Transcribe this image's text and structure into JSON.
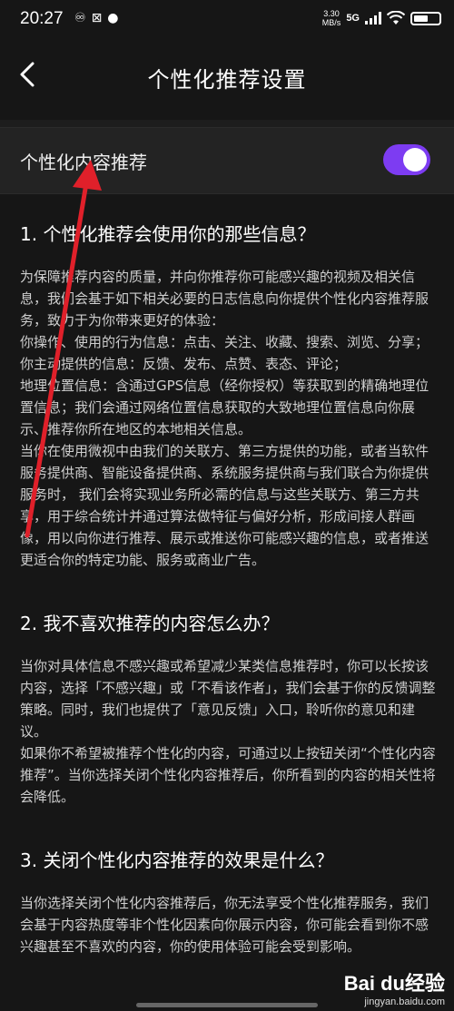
{
  "status": {
    "time": "20:27",
    "left_icons": [
      "♾",
      "⊠",
      "●"
    ],
    "speed_top": "3.30",
    "speed_bottom": "MB/s",
    "network": "5G",
    "battery_level_percent": 56
  },
  "header": {
    "title": "个性化推荐设置"
  },
  "toggle": {
    "label": "个性化内容推荐",
    "on": true,
    "color": "#7d3cf2"
  },
  "sections": [
    {
      "title": "1. 个性化推荐会使用你的那些信息？",
      "paragraphs": [
        "为保障推荐内容的质量，并向你推荐你可能感兴趣的视频及相关信息，我们会基于如下相关必要的日志信息向你提供个性化内容推荐服务，致力于为你带来更好的体验：",
        "你操作、使用的行为信息：点击、关注、收藏、搜索、浏览、分享；",
        "你主动提供的信息：反馈、发布、点赞、表态、评论；",
        "地理位置信息：含通过GPS信息（经你授权）等获取到的精确地理位置信息；我们会通过网络位置信息获取的大致地理位置信息向你展示、推荐你所在地区的本地相关信息。",
        "当你在使用微视中由我们的关联方、第三方提供的功能，或者当软件服务提供商、智能设备提供商、系统服务提供商与我们联合为你提供服务时， 我们会将实现业务所必需的信息与这些关联方、第三方共享，用于综合统计并通过算法做特征与偏好分析，形成间接人群画像，用以向你进行推荐、展示或推送你可能感兴趣的信息，或者推送更适合你的特定功能、服务或商业广告。"
      ]
    },
    {
      "title": "2. 我不喜欢推荐的内容怎么办？",
      "paragraphs": [
        "当你对具体信息不感兴趣或希望减少某类信息推荐时，你可以长按该内容，选择「不感兴趣」或「不看该作者」，我们会基于你的反馈调整策略。同时，我们也提供了「意见反馈」入口，聆听你的意见和建议。",
        "如果你不希望被推荐个性化的内容，可通过以上按钮关闭“个性化内容推荐”。当你选择关闭个性化内容推荐后，你所看到的内容的相关性将会降低。"
      ]
    },
    {
      "title": "3. 关闭个性化内容推荐的效果是什么？",
      "paragraphs": [
        "当你选择关闭个性化内容推荐后，你无法享受个性化推荐服务，我们会基于内容热度等非个性化因素向你展示内容，你可能会看到你不感兴趣甚至不喜欢的内容，你的使用体验可能会受到影响。"
      ]
    }
  ],
  "watermark": {
    "logo": "Bai du经验",
    "site": "jingyan.baidu.com"
  },
  "annotation_color": "#e0202a"
}
